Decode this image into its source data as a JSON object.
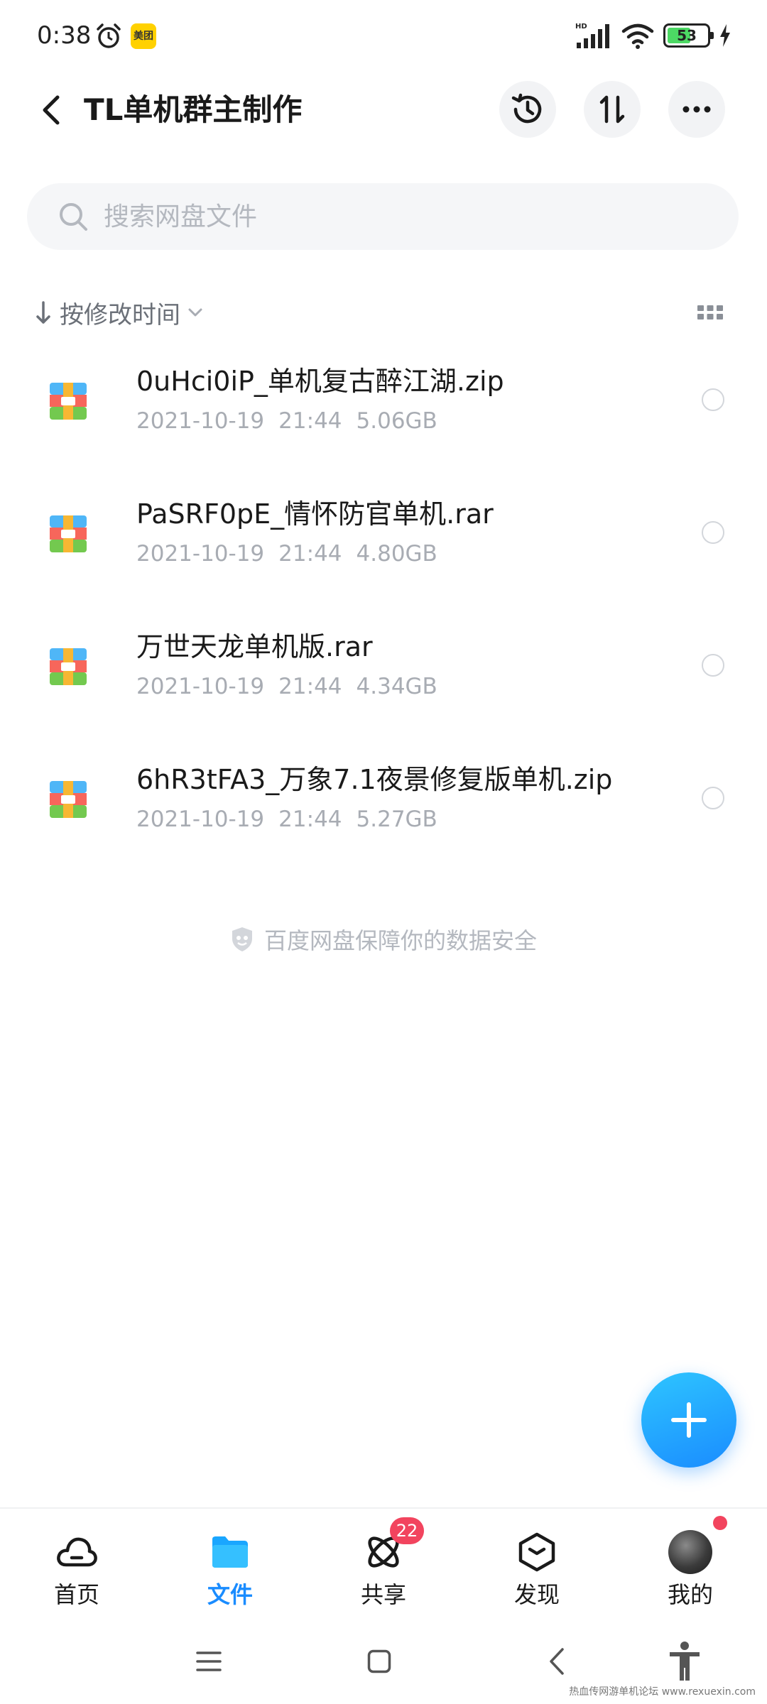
{
  "status_bar": {
    "time": "0:38",
    "app_badge": "美团",
    "network": "HD",
    "battery": "53"
  },
  "header": {
    "title": "TL单机群主制作",
    "icons": [
      "back-icon",
      "history-icon",
      "transfer-icon",
      "more-icon"
    ]
  },
  "search": {
    "placeholder": "搜索网盘文件"
  },
  "sort": {
    "label": "按修改时间"
  },
  "files": [
    {
      "name": "0uHci0iP_单机复古醉江湖.zip",
      "date": "2021-10-19",
      "time": "21:44",
      "size": "5.06GB"
    },
    {
      "name": "PaSRF0pE_情怀防官单机.rar",
      "date": "2021-10-19",
      "time": "21:44",
      "size": "4.80GB"
    },
    {
      "name": "万世天龙单机版.rar",
      "date": "2021-10-19",
      "time": "21:44",
      "size": "4.34GB"
    },
    {
      "name": "6hR3tFA3_万象7.1夜景修复版单机.zip",
      "date": "2021-10-19",
      "time": "21:44",
      "size": "5.27GB"
    }
  ],
  "safety_note": "百度网盘保障你的数据安全",
  "tabs": [
    {
      "label": "首页",
      "icon": "cloud-icon",
      "active": false
    },
    {
      "label": "文件",
      "icon": "folder-icon",
      "active": true
    },
    {
      "label": "共享",
      "icon": "share-icon",
      "active": false,
      "badge": "22"
    },
    {
      "label": "发现",
      "icon": "discover-icon",
      "active": false
    },
    {
      "label": "我的",
      "icon": "avatar",
      "active": false
    }
  ],
  "colors": {
    "accent": "#1a8cff",
    "badge": "#f2445e",
    "text_secondary": "#a8acb3"
  },
  "watermark": "热血传网游单机论坛 www.rexuexin.com"
}
